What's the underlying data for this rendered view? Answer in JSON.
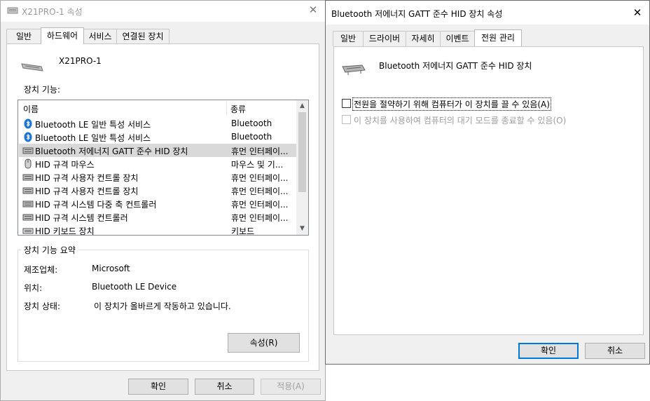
{
  "window_left": {
    "title": "X21PRO-1 속성",
    "tabs": [
      "일반",
      "하드웨어",
      "서비스",
      "연결된 장치"
    ],
    "active_tab": "하드웨어",
    "device_name": "X21PRO-1",
    "functions_label": "장치 기능:",
    "list": {
      "columns": [
        "이름",
        "종류"
      ],
      "rows": [
        {
          "name": "Bluetooth LE 일반 특성 서비스",
          "type": "Bluetooth",
          "icon": "bluetooth-icon",
          "selected": false
        },
        {
          "name": "Bluetooth LE 일반 특성 서비스",
          "type": "Bluetooth",
          "icon": "bluetooth-icon",
          "selected": false
        },
        {
          "name": "Bluetooth 저에너지 GATT 준수 HID 장치",
          "type": "휴먼 인터페이...",
          "icon": "hid-device-icon",
          "selected": true
        },
        {
          "name": "HID 규격 마우스",
          "type": "마우스 및 기...",
          "icon": "mouse-icon",
          "selected": false
        },
        {
          "name": "HID 규격 사용자 컨트롤 장치",
          "type": "휴먼 인터페이...",
          "icon": "hid-device-icon",
          "selected": false
        },
        {
          "name": "HID 규격 사용자 컨트롤 장치",
          "type": "휴먼 인터페이...",
          "icon": "hid-device-icon",
          "selected": false
        },
        {
          "name": "HID 규격 시스템 다중 축 컨트롤러",
          "type": "휴먼 인터페이...",
          "icon": "hid-device-icon",
          "selected": false
        },
        {
          "name": "HID 규격 시스템 컨트롤러",
          "type": "휴먼 인터페이...",
          "icon": "hid-device-icon",
          "selected": false
        },
        {
          "name": "HID 키보드 장치",
          "type": "키보드",
          "icon": "keyboard-icon",
          "selected": false
        }
      ]
    },
    "summary": {
      "title": "장치 기능 요약",
      "manufacturer_label": "제조업체:",
      "manufacturer": "Microsoft",
      "location_label": "위치:",
      "location": "Bluetooth LE Device",
      "status_label": "장치 상태:",
      "status": "이 장치가 올바르게 작동하고 있습니다.",
      "properties_button": "속성(R)"
    },
    "buttons": {
      "ok": "확인",
      "cancel": "취소",
      "apply": "적용(A)"
    }
  },
  "window_right": {
    "title": "Bluetooth 저에너지 GATT 준수 HID 장치 속성",
    "tabs": [
      "일반",
      "드라이버",
      "자세히",
      "이벤트",
      "전원 관리"
    ],
    "active_tab": "전원 관리",
    "device_name": "Bluetooth 저에너지 GATT 준수 HID 장치",
    "option_power_off": "전원을 절약하기 위해 컴퓨터가 이 장치를 끌 수 있음(A)",
    "option_power_off_checked": false,
    "option_wake": "이 장치를 사용하여 컴퓨터의 대기 모드를 종료할 수 있음(O)",
    "option_wake_checked": false,
    "option_wake_enabled": false,
    "buttons": {
      "ok": "확인",
      "cancel": "취소"
    }
  },
  "colors": {
    "accent": "#0078d7",
    "selection": "#d9d9d9",
    "window_bg": "#f0f0f0"
  }
}
